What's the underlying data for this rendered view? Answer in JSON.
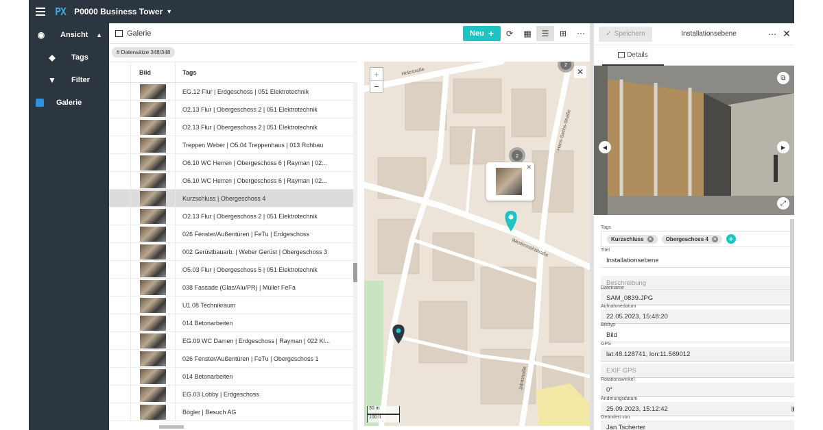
{
  "topbar": {
    "logo": "PX",
    "project": "P0000 Business Tower"
  },
  "sidebar": {
    "view_label": "Ansicht",
    "items": [
      {
        "label": "Tags"
      },
      {
        "label": "Filter"
      }
    ],
    "gallery_label": "Galerie"
  },
  "gallery": {
    "title": "Galerie",
    "new_label": "Neu",
    "record_count": "# Datensätze 348/348",
    "columns": {
      "image": "Bild",
      "tags": "Tags"
    },
    "rows": [
      {
        "tags": "EG.12 Flur | Erdgeschoss | 051 Elektrotechnik"
      },
      {
        "tags": "O2.13 Flur | Obergeschoss 2 | 051 Elektrotechnik"
      },
      {
        "tags": "O2.13 Flur | Obergeschoss 2 | 051 Elektrotechnik"
      },
      {
        "tags": "Treppen Weber | O5.04 Treppenhaus | 013 Rohbau"
      },
      {
        "tags": "O6.10 WC Herren | Obergeschoss 6 | Rayman | 02..."
      },
      {
        "tags": "O6.10 WC Herren | Obergeschoss 6 | Rayman | 02..."
      },
      {
        "tags": "Kurzschluss | Obergeschoss 4",
        "selected": true
      },
      {
        "tags": "O2.13 Flur | Obergeschoss 2 | 051 Elektrotechnik"
      },
      {
        "tags": "026 Fenster/Außentüren | FeTu | Erdgeschoss"
      },
      {
        "tags": "002 Gerüstbauarb. | Weber Gerüst | Obergeschoss 3"
      },
      {
        "tags": "O5.03 Flur | Obergeschoss 5 | 051 Elektrotechnik"
      },
      {
        "tags": "038 Fassade (Glas/Alu/PR) | Müller FeFa"
      },
      {
        "tags": "U1.08 Technikraum"
      },
      {
        "tags": "014 Betonarbeiten"
      },
      {
        "tags": "EG.09 WC Damen | Erdgeschoss | Rayman | 022 Kl..."
      },
      {
        "tags": "026 Fenster/Außentüren | FeTu | Obergeschoss 1"
      },
      {
        "tags": "014 Betonarbeiten"
      },
      {
        "tags": "EG.03 Lobby | Erdgeschoss"
      },
      {
        "tags": "Bögler | Besuch AG"
      }
    ]
  },
  "map": {
    "streets": [
      "Holzstraße",
      "Westermühlstraße",
      "Hans-Sachs-Straße",
      "Jahnstraße"
    ],
    "cluster_counts": [
      "2",
      "2"
    ],
    "scale": {
      "metric": "30 m",
      "imperial": "100 ft"
    }
  },
  "detail": {
    "save_label": "Speichern",
    "title": "Installationsebene",
    "tab_label": "Details",
    "fields": {
      "tags_label": "Tags",
      "tags": [
        "Kurzschluss",
        "Obergeschoss 4"
      ],
      "title_label": "Titel",
      "title_value": "Installationsebene",
      "description_placeholder": "Beschreibung",
      "filename_label": "Dateiname",
      "filename_value": "SAM_0839.JPG",
      "captured_label": "Aufnahmedatum",
      "captured_value": "22.05.2023, 15:48:20",
      "type_label": "Bildtyp",
      "type_value": "Bild",
      "gps_label": "GPS",
      "gps_value": "lat:48.128741, lon:11.569012",
      "exif_placeholder": "EXIF GPS",
      "rotation_label": "Rotationswinkel",
      "rotation_value": "0°",
      "modified_label": "Änderungsdatum",
      "modified_value": "25.09.2023, 15:12:42",
      "changed_by_label": "Geändert von",
      "changed_by_value": "Jan Tscherter"
    }
  },
  "colors": {
    "accent": "#1fc3c4",
    "nav_bg": "#2b3640",
    "gallery_icon": "#2f8fe0"
  }
}
